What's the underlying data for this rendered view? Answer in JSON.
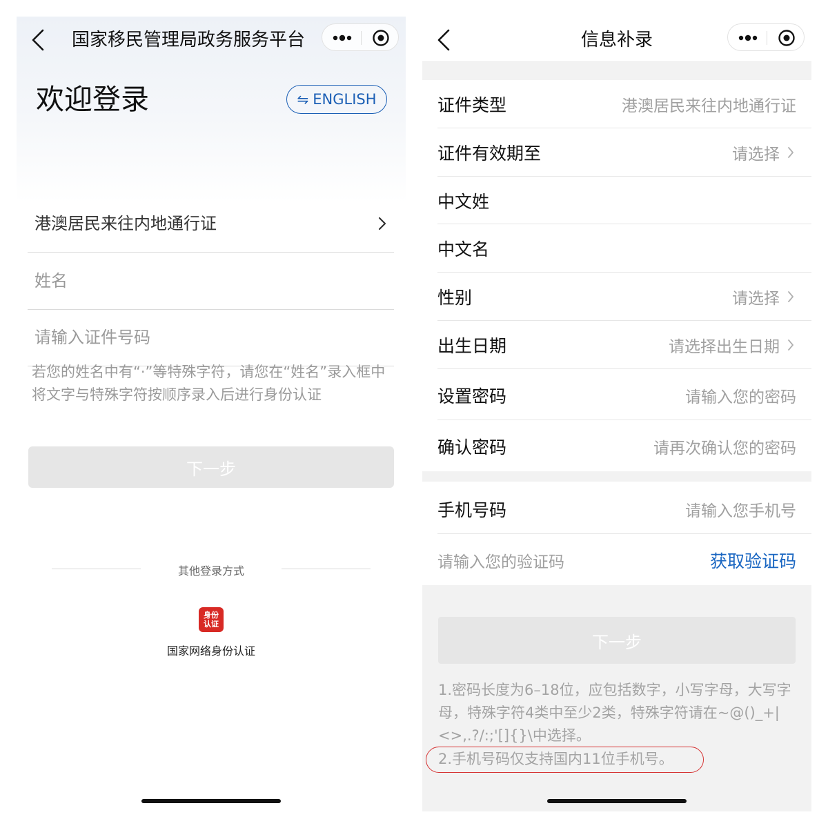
{
  "left": {
    "nav": {
      "title": "国家移民管理局政务服务平台"
    },
    "welcome": "欢迎登录",
    "lang_button": {
      "icon": "swap-icon",
      "label": "ENGLISH"
    },
    "doc_type": "港澳居民来往内地通行证",
    "name_placeholder": "姓名",
    "id_placeholder": "请输入证件号码",
    "hint": "若您的姓名中有“·”等特殊字符，请您在“姓名”录入框中将文字与特殊字符按顺序录入后进行身份认证",
    "next_button": "下一步",
    "other_login": "其他登录方式",
    "id_logo": {
      "line1": "身份",
      "line2": "认证",
      "color": "#d82a25"
    },
    "id_auth_label": "国家网络身份认证"
  },
  "right": {
    "nav": {
      "title": "信息补录"
    },
    "rows": [
      {
        "label": "证件类型",
        "value": "港澳居民来往内地通行证",
        "selectable": false
      },
      {
        "label": "证件有效期至",
        "value": "请选择",
        "selectable": true
      },
      {
        "label": "中文姓",
        "value": "",
        "selectable": false
      },
      {
        "label": "中文名",
        "value": "",
        "selectable": false
      },
      {
        "label": "性别",
        "value": "请选择",
        "selectable": true
      },
      {
        "label": "出生日期",
        "value": "请选择出生日期",
        "selectable": true
      },
      {
        "label": "设置密码",
        "value": "请输入您的密码",
        "selectable": false
      },
      {
        "label": "确认密码",
        "value": "请再次确认您的密码",
        "selectable": false
      }
    ],
    "phone": {
      "label": "手机号码",
      "placeholder": "请输入您手机号"
    },
    "code": {
      "placeholder": "请输入您的验证码",
      "link": "获取验证码"
    },
    "next_button": "下一步",
    "note1": "1.密码长度为6–18位，应包括数字，小写字母，大写字母，特殊字符4类中至少2类，特殊字符请在~@()_+|<>,.?/:;'[]{}\\中选择。",
    "note2": "2.手机号码仅支持国内11位手机号。"
  },
  "colors": {
    "accent_blue": "#1b5fb5",
    "link_blue": "#1b67c2",
    "annotation_red": "#d63333",
    "disabled_button": "#e6e6e6"
  }
}
